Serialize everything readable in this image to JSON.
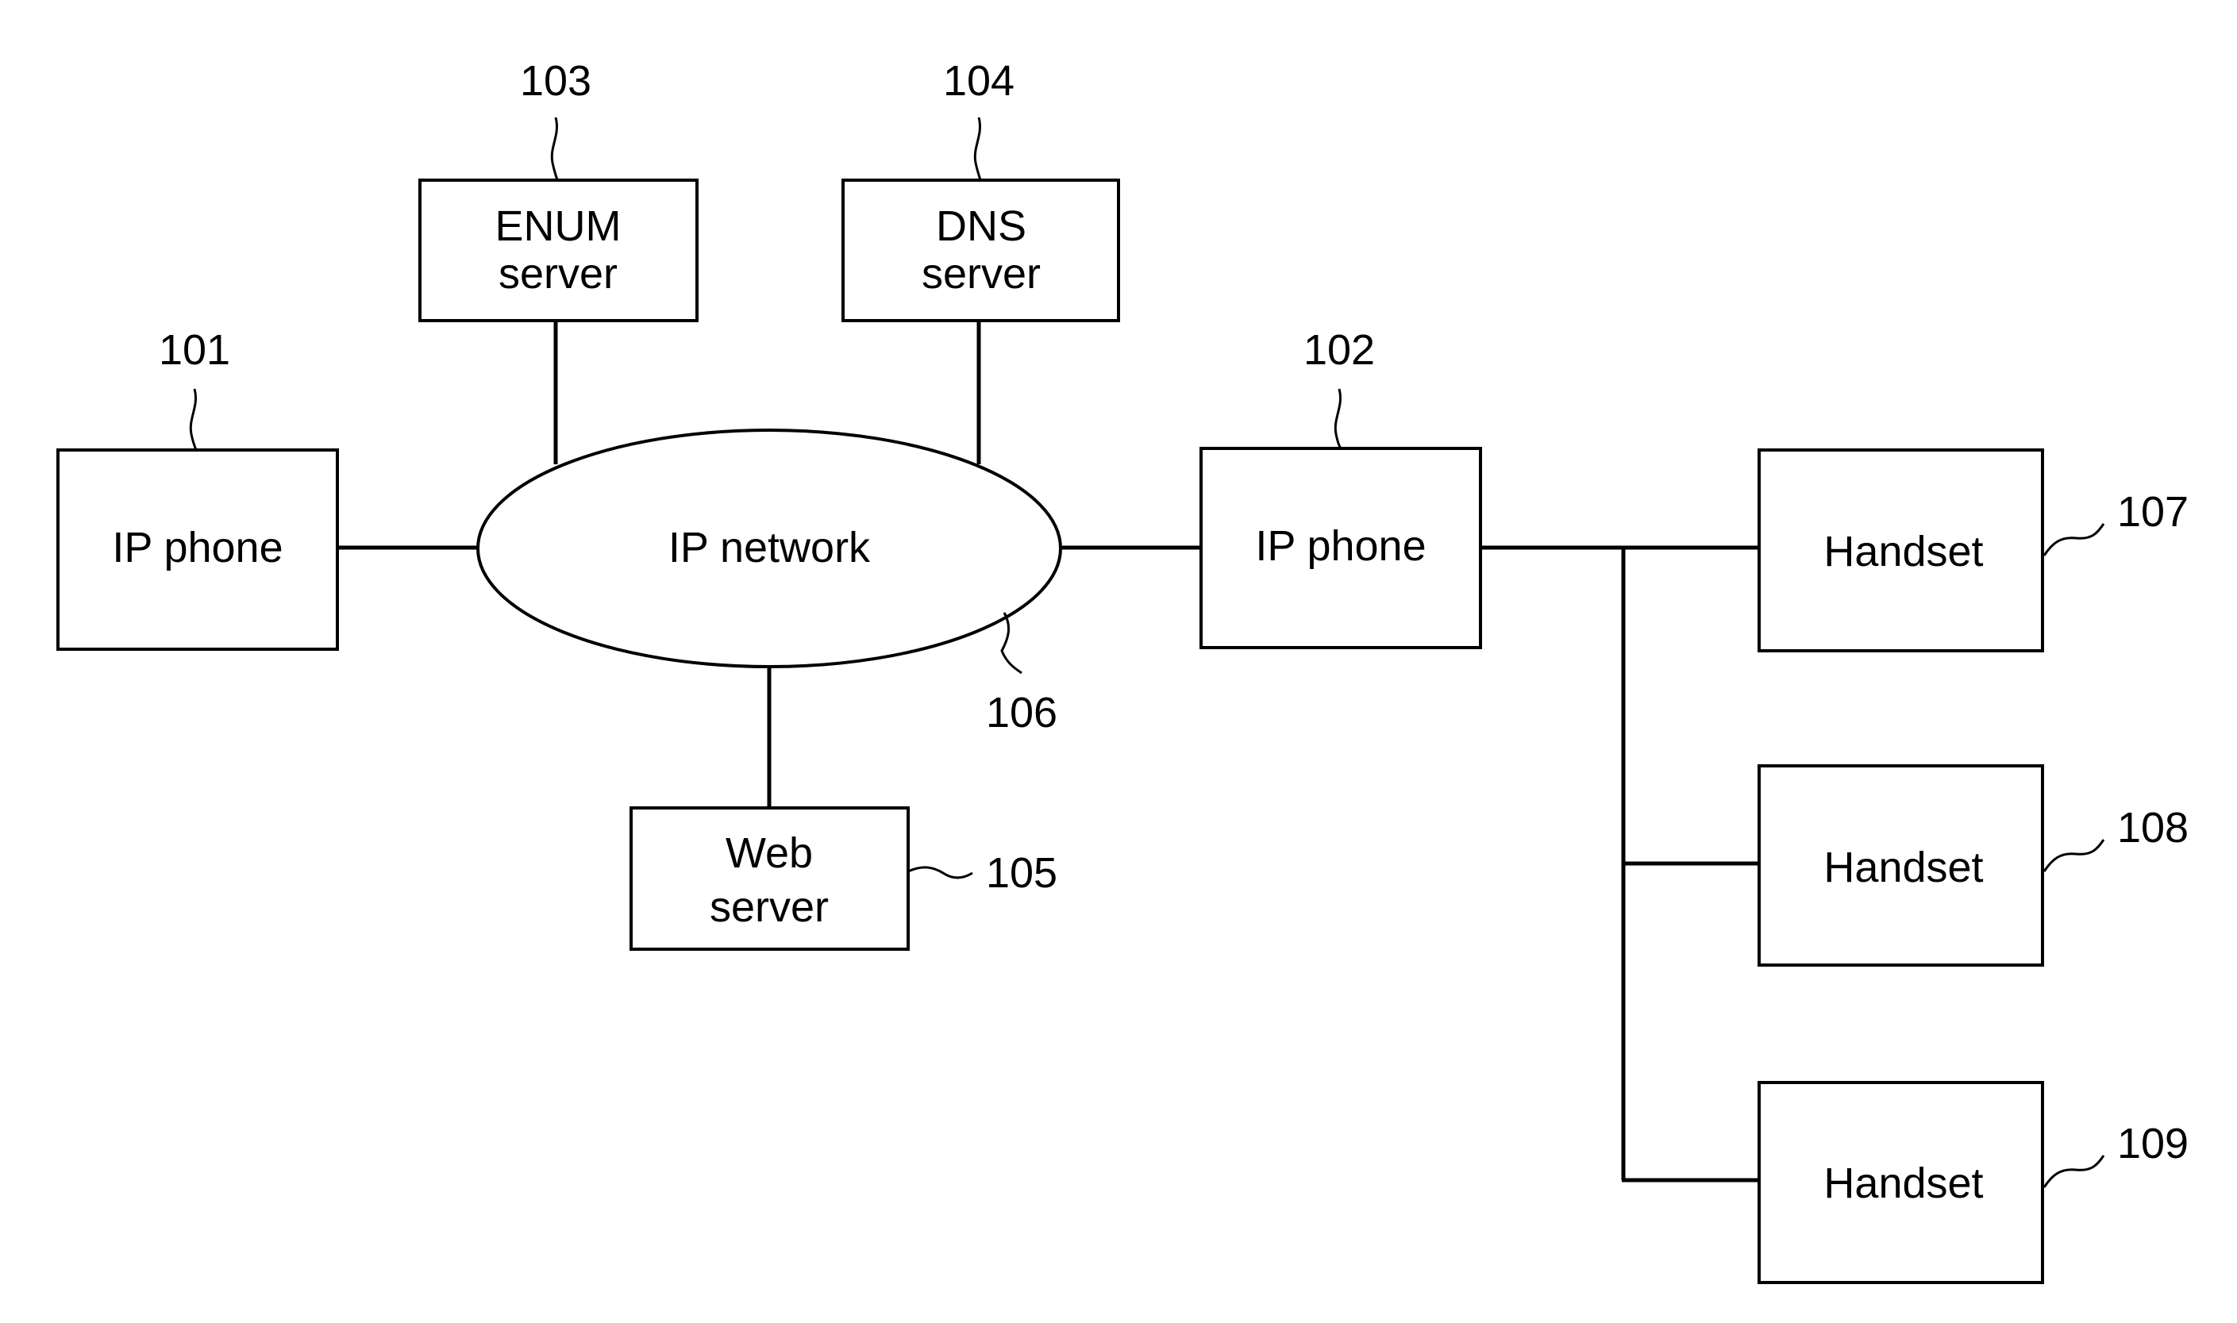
{
  "diagram": {
    "nodes": [
      {
        "id": "ip_phone_101",
        "ref": "101",
        "lines": [
          "IP phone"
        ],
        "shape": "rect"
      },
      {
        "id": "ip_phone_102",
        "ref": "102",
        "lines": [
          "IP phone"
        ],
        "shape": "rect"
      },
      {
        "id": "enum_server",
        "ref": "103",
        "lines": [
          "ENUM",
          "server"
        ],
        "shape": "rect"
      },
      {
        "id": "dns_server",
        "ref": "104",
        "lines": [
          "DNS",
          "server"
        ],
        "shape": "rect"
      },
      {
        "id": "web_server",
        "ref": "105",
        "lines": [
          "Web",
          "server"
        ],
        "shape": "rect"
      },
      {
        "id": "ip_network",
        "ref": "106",
        "lines": [
          "IP network"
        ],
        "shape": "ellipse"
      },
      {
        "id": "handset_107",
        "ref": "107",
        "lines": [
          "Handset"
        ],
        "shape": "rect"
      },
      {
        "id": "handset_108",
        "ref": "108",
        "lines": [
          "Handset"
        ],
        "shape": "rect"
      },
      {
        "id": "handset_109",
        "ref": "109",
        "lines": [
          "Handset"
        ],
        "shape": "rect"
      }
    ],
    "edges": [
      {
        "from": "ip_phone_101",
        "to": "ip_network"
      },
      {
        "from": "enum_server",
        "to": "ip_network"
      },
      {
        "from": "dns_server",
        "to": "ip_network"
      },
      {
        "from": "web_server",
        "to": "ip_network"
      },
      {
        "from": "ip_network",
        "to": "ip_phone_102"
      },
      {
        "from": "ip_phone_102",
        "to": "handset_107"
      },
      {
        "from": "ip_phone_102",
        "to": "handset_108"
      },
      {
        "from": "ip_phone_102",
        "to": "handset_109"
      }
    ]
  }
}
